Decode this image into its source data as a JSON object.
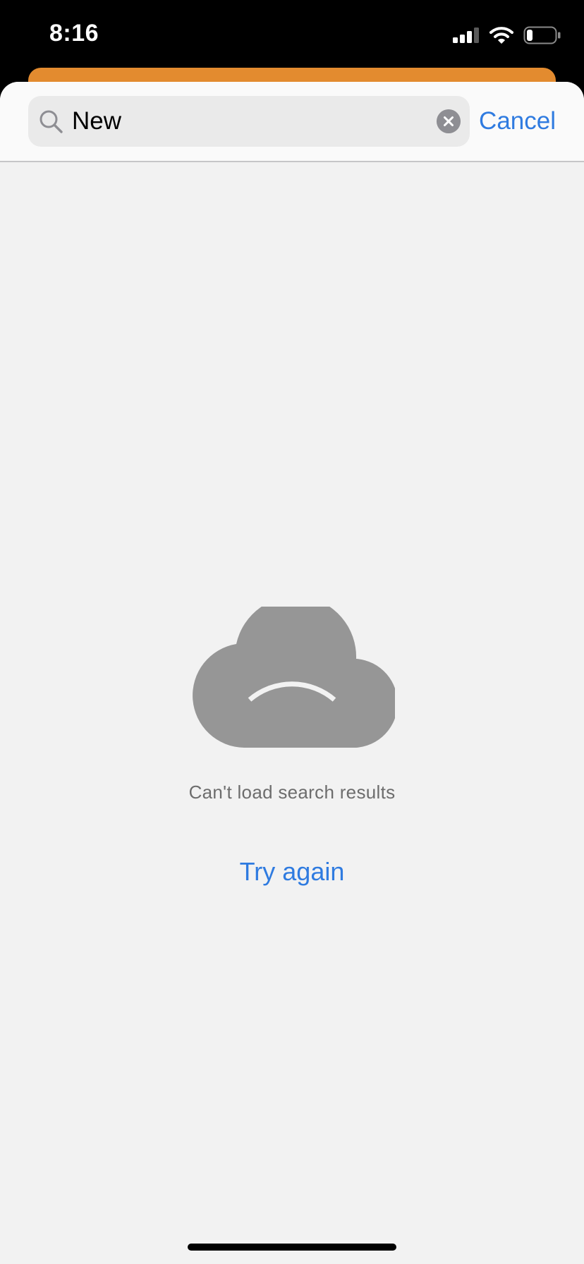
{
  "status_bar": {
    "time": "8:16",
    "icons": [
      "cellular-signal-icon",
      "wifi-icon",
      "battery-icon"
    ]
  },
  "search": {
    "query": "New",
    "cancel_label": "Cancel",
    "icon": "search-icon",
    "clear_icon": "clear-icon"
  },
  "empty_state": {
    "icon": "sad-cloud-icon",
    "message": "Can't load search results",
    "retry_label": "Try again"
  },
  "colors": {
    "accent": "#2f7be0",
    "sheet_behind": "#e38b2f",
    "background": "#f2f2f2",
    "icon_gray": "#969696"
  }
}
